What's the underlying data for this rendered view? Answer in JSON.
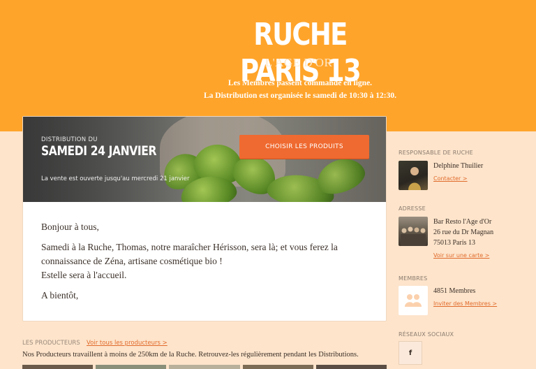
{
  "header": {
    "title": "RUCHE PARIS 13",
    "subtitle": "L'AGE D'OR",
    "tagline_line1": "Les Membres passent commande en ligne.",
    "tagline_line2": "La Distribution est organisée le samedi de 10:30 à 12:30."
  },
  "distribution": {
    "label": "DISTRIBUTION DU",
    "date": "SAMEDI 24 JANVIER",
    "sale_notice": "La vente est ouverte jusqu'au mercredi 21 janvier",
    "choose_button": "CHOISIR LES PRODUITS"
  },
  "message": {
    "greeting": "Bonjour à tous,",
    "line1": "Samedi à la Ruche, Thomas, notre maraîcher Hérisson, sera là; et vous ferez la",
    "line2": "connaissance de Zéna, artisane cosmétique bio !",
    "line3": "Estelle sera à l'accueil.",
    "closing": "A bientôt,"
  },
  "producers": {
    "heading": "LES PRODUCTEURS",
    "see_all": "Voir tous les producteurs >",
    "description": "Nos Producteurs travaillent à moins de 250km de la Ruche. Retrouvez-les régulièrement pendant les Distributions."
  },
  "sidebar": {
    "manager": {
      "heading": "RESPONSABLE DE RUCHE",
      "name": "Delphine Thuilier",
      "link": "Contacter >"
    },
    "address": {
      "heading": "ADRESSE",
      "line1": "Bar Resto l'Age d'Or",
      "line2": "26 rue du Dr Magnan",
      "line3": "75013 Paris 13",
      "link": "Voir sur une carte >"
    },
    "members": {
      "heading": "MEMBRES",
      "count": "4851 Membres",
      "link": "Inviter des Membres >"
    },
    "social": {
      "heading": "RÉSEAUX SOCIAUX",
      "facebook": "f"
    }
  },
  "colors": {
    "header_orange": "#ffa42a",
    "page_peach": "#fde4cb",
    "button_orange": "#ef6a30",
    "link_orange": "#e16b2b"
  }
}
